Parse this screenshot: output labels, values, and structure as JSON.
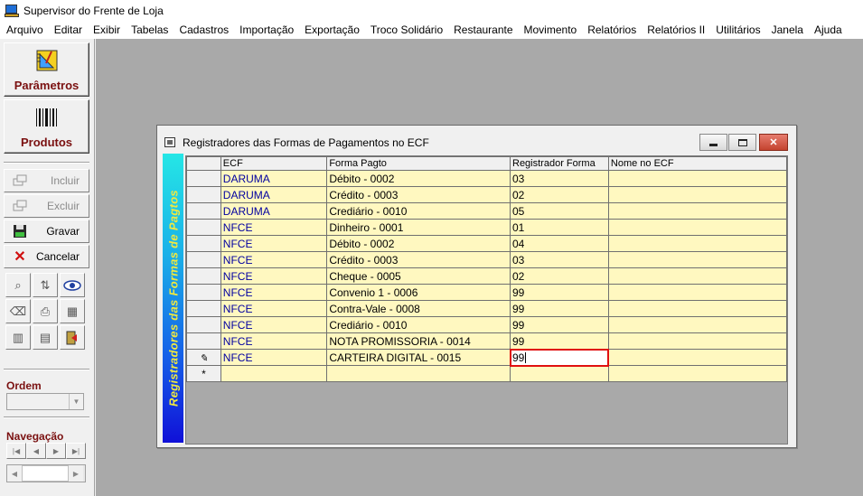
{
  "app": {
    "title": "Supervisor do Frente de Loja"
  },
  "menu": [
    "Arquivo",
    "Editar",
    "Exibir",
    "Tabelas",
    "Cadastros",
    "Importação",
    "Exportação",
    "Troco Solidário",
    "Restaurante",
    "Movimento",
    "Relatórios",
    "Relatórios II",
    "Utilitários",
    "Janela",
    "Ajuda"
  ],
  "toolbar": {
    "parametros": "Parâmetros",
    "produtos": "Produtos",
    "incluir": "Incluir",
    "excluir": "Excluir",
    "gravar": "Gravar",
    "cancelar": "Cancelar",
    "ordem_label": "Ordem",
    "ordem_value": "",
    "navegacao_label": "Navegação"
  },
  "window": {
    "title": "Registradores das Formas de Pagamentos no ECF",
    "banner": "Registradores das Formas de Pagtos"
  },
  "grid": {
    "columns": [
      "ECF",
      "Forma Pagto",
      "Registrador Forma",
      "Nome no ECF"
    ],
    "rows": [
      [
        "DARUMA",
        "Débito  -  0002",
        "03",
        ""
      ],
      [
        "DARUMA",
        "Crédito  -  0003",
        "02",
        ""
      ],
      [
        "DARUMA",
        "Crediário  -  0010",
        "05",
        ""
      ],
      [
        "NFCE",
        "Dinheiro  -  0001",
        "01",
        ""
      ],
      [
        "NFCE",
        "Débito  -  0002",
        "04",
        ""
      ],
      [
        "NFCE",
        "Crédito  -  0003",
        "03",
        ""
      ],
      [
        "NFCE",
        "Cheque  -  0005",
        "02",
        ""
      ],
      [
        "NFCE",
        "Convenio 1  -  0006",
        "99",
        ""
      ],
      [
        "NFCE",
        "Contra-Vale  -  0008",
        "99",
        ""
      ],
      [
        "NFCE",
        "Crediário  -  0010",
        "99",
        ""
      ],
      [
        "NFCE",
        "NOTA PROMISSORIA  -  0014",
        "99",
        ""
      ],
      [
        "NFCE",
        "CARTEIRA DIGITAL  -  0015",
        "99",
        ""
      ]
    ],
    "editing_row": 11,
    "new_row_marker": "*"
  }
}
